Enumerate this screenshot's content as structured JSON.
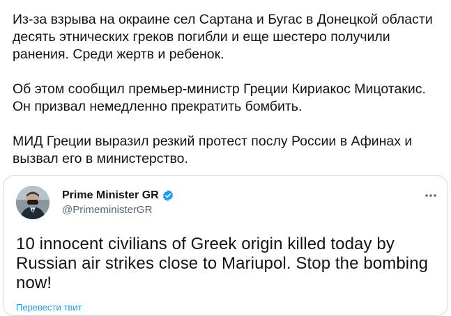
{
  "tweet": {
    "paragraphs": [
      "Из-за взрыва на окраине сел Сартана и Бугас в Донецкой области\nдесять этнических греков погибли и еще шестеро получили\nранения. Среди жертв и ребенок.",
      "Об этом сообщил премьер-министр Греции Кириакос Мицотакис.\nОн призвал немедленно прекратить бомбить.",
      "МИД Греции выразил резкий протест послу России в Афинах и\nвызвал его в министерство."
    ]
  },
  "quoted_tweet": {
    "author_name": "Prime Minister GR",
    "author_handle": "@PrimeministerGR",
    "verified": true,
    "avatar_icon": "person-avatar",
    "more_icon": "more-dots-icon",
    "body": "10 innocent civilians of Greek origin killed today by Russian air strikes close to Mariupol. Stop the bombing now!",
    "translate_label": "Перевести твит"
  },
  "colors": {
    "text": "#0f1419",
    "secondary_text": "#536471",
    "accent": "#1d9bf0",
    "border": "#cfd9de"
  }
}
